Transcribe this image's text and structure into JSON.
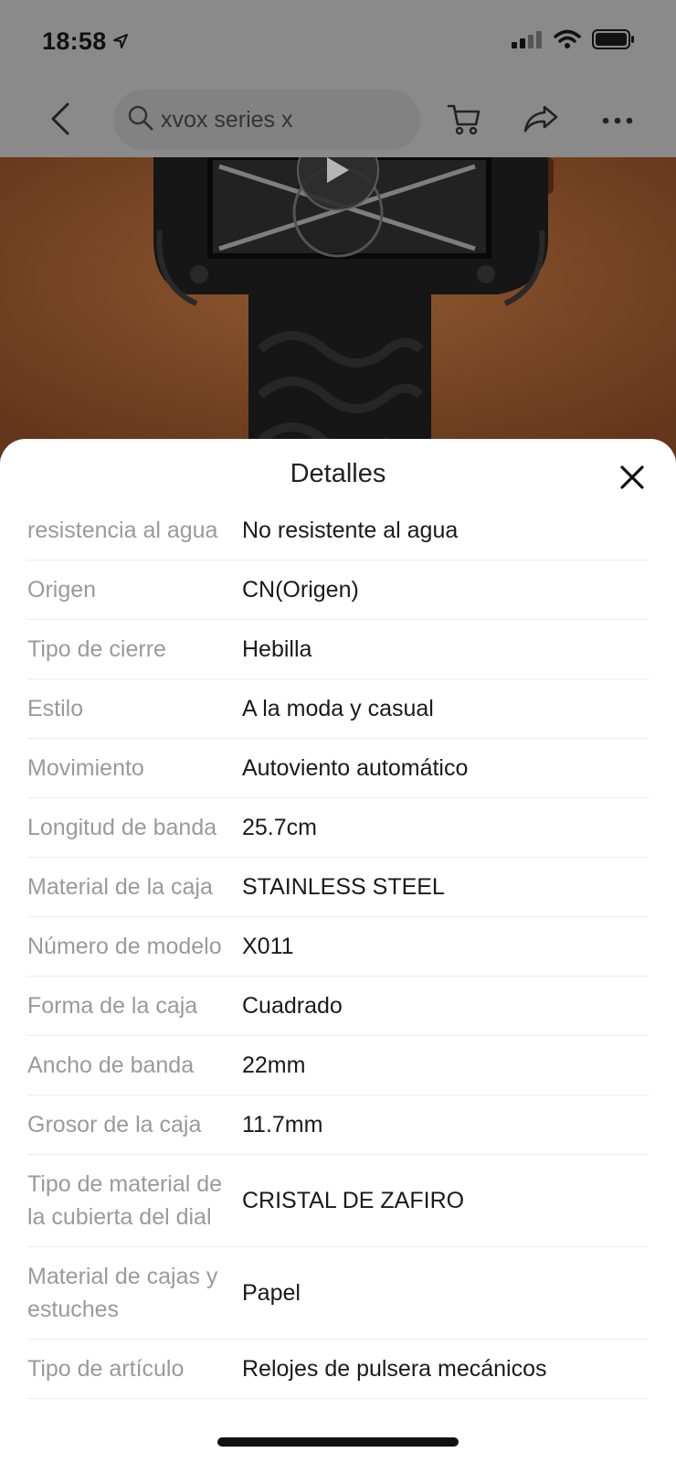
{
  "status_bar": {
    "time": "18:58"
  },
  "search_header": {
    "query": "xvox series x"
  },
  "sheet": {
    "title": "Detalles",
    "rows": [
      {
        "label": "resistencia al agua",
        "value": "No resistente al agua"
      },
      {
        "label": "Origen",
        "value": "CN(Origen)"
      },
      {
        "label": "Tipo de cierre",
        "value": "Hebilla"
      },
      {
        "label": "Estilo",
        "value": "A la moda y casual"
      },
      {
        "label": "Movimiento",
        "value": "Autoviento automático"
      },
      {
        "label": "Longitud de banda",
        "value": "25.7cm"
      },
      {
        "label": "Material de la caja",
        "value": "STAINLESS STEEL"
      },
      {
        "label": "Número de modelo",
        "value": "X011"
      },
      {
        "label": "Forma de la caja",
        "value": "Cuadrado"
      },
      {
        "label": "Ancho de banda",
        "value": "22mm"
      },
      {
        "label": "Grosor de la caja",
        "value": "11.7mm"
      },
      {
        "label": "Tipo de material de la cubierta del dial",
        "value": "CRISTAL DE ZAFIRO"
      },
      {
        "label": "Material de cajas y estuches",
        "value": "Papel"
      },
      {
        "label": "Tipo de artículo",
        "value": "Relojes de pulsera mecánicos"
      }
    ]
  },
  "icons": {
    "back": "chevron-left-icon",
    "search": "search-icon",
    "cart": "cart-icon",
    "share": "share-icon",
    "more": "more-icon",
    "close": "close-icon",
    "location": "location-arrow-icon",
    "signal": "signal-icon",
    "wifi": "wifi-icon",
    "battery": "battery-icon",
    "play": "play-icon"
  }
}
